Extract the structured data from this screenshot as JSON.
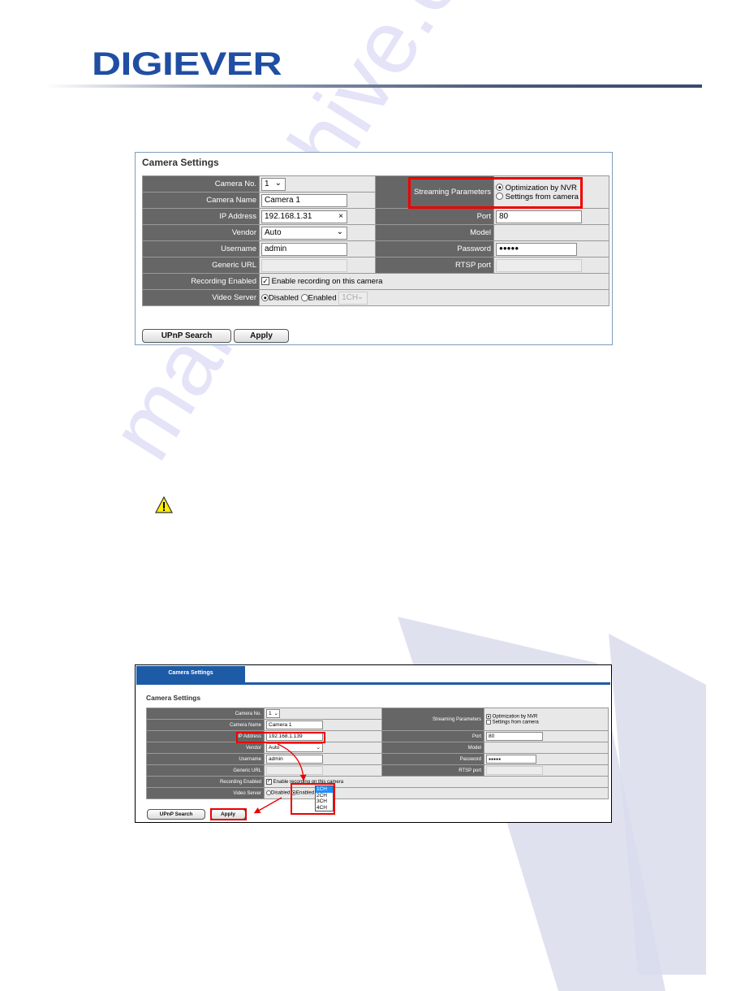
{
  "header": {
    "logo_text": "DIGIEVER"
  },
  "watermark": "manualshive.com",
  "colors": {
    "brand": "#1f4ea3",
    "highlight": "#e00000",
    "label_bg": "#666666",
    "tab_blue": "#1d5ba6"
  },
  "panel1": {
    "title": "Camera Settings",
    "labels": {
      "camera_no": "Camera No.",
      "camera_name": "Camera Name",
      "ip_address": "IP Address",
      "vendor": "Vendor",
      "username": "Username",
      "generic_url": "Generic URL",
      "recording_enabled": "Recording Enabled",
      "video_server": "Video Server",
      "streaming_parameters": "Streaming Parameters",
      "port": "Port",
      "model": "Model",
      "password": "Password",
      "rtsp_port": "RTSP port"
    },
    "values": {
      "camera_no": "1",
      "camera_name": "Camera 1",
      "ip_address": "192.168.1.31",
      "vendor": "Auto",
      "username": "admin",
      "generic_url": "",
      "port": "80",
      "model": "",
      "password": "●●●●●",
      "rtsp_port": ""
    },
    "streaming_options": [
      {
        "label": "Optimization by NVR",
        "selected": true
      },
      {
        "label": "Settings from camera",
        "selected": false
      }
    ],
    "recording_checkbox": {
      "label": "Enable recording on this camera",
      "checked": true
    },
    "video_server": {
      "disabled_label": "Disabled",
      "enabled_label": "Enabled",
      "selected": "Disabled",
      "channel": "1CH"
    },
    "buttons": {
      "upnp": "UPnP Search",
      "apply": "Apply"
    },
    "clear_icon": "×"
  },
  "panel2": {
    "tab_label": "Camera Settings",
    "title": "Camera Settings",
    "labels": {
      "camera_no": "Camera No.",
      "camera_name": "Camera Name",
      "ip_address": "IP Address",
      "vendor": "Vendor",
      "username": "Username",
      "generic_url": "Generic URL",
      "recording_enabled": "Recording Enabled",
      "video_server": "Video Server",
      "streaming_parameters": "Streaming Parameters",
      "port": "Port",
      "model": "Model",
      "password": "Password",
      "rtsp_port": "RTSP port"
    },
    "values": {
      "camera_no": "1",
      "camera_name": "Camera 1",
      "ip_address": "192.168.1.139",
      "vendor": "Auto",
      "username": "admin",
      "port": "80",
      "password": "●●●●●"
    },
    "streaming_options": [
      {
        "label": "Optimization by NVR",
        "selected": true
      },
      {
        "label": "Settings from camera",
        "selected": false
      }
    ],
    "recording_checkbox": {
      "label": "Enable recording on this camera",
      "checked": true
    },
    "video_server": {
      "disabled_label": "Disabled",
      "enabled_label": "Enabled",
      "selected": "Enabled"
    },
    "channel_options": [
      "1CH",
      "2CH",
      "3CH",
      "4CH"
    ],
    "channel_selected": "1CH",
    "buttons": {
      "upnp": "UPnP Search",
      "apply": "Apply"
    }
  }
}
